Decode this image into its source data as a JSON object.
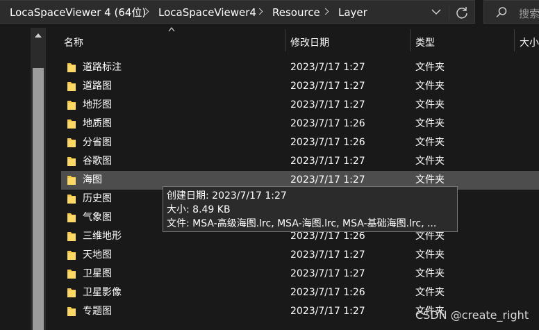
{
  "address_bar": {
    "breadcrumbs": [
      "LocaSpaceViewer 4 (64位)",
      "LocaSpaceViewer4",
      "Resource",
      "Layer"
    ]
  },
  "search": {
    "placeholder": "搜索"
  },
  "columns": {
    "name": "名称",
    "date": "修改日期",
    "type": "类型",
    "size": "大小"
  },
  "rows": [
    {
      "name": "道路标注",
      "date": "2023/7/17 1:27",
      "type": "文件夹"
    },
    {
      "name": "道路图",
      "date": "2023/7/17 1:27",
      "type": "文件夹"
    },
    {
      "name": "地形图",
      "date": "2023/7/17 1:27",
      "type": "文件夹"
    },
    {
      "name": "地质图",
      "date": "2023/7/17 1:26",
      "type": "文件夹"
    },
    {
      "name": "分省图",
      "date": "2023/7/17 1:26",
      "type": "文件夹"
    },
    {
      "name": "谷歌图",
      "date": "2023/7/17 1:27",
      "type": "文件夹"
    },
    {
      "name": "海图",
      "date": "2023/7/17 1:27",
      "type": "文件夹"
    },
    {
      "name": "历史图",
      "date": "",
      "type": ""
    },
    {
      "name": "气象图",
      "date": "",
      "type": ""
    },
    {
      "name": "三维地形",
      "date": "2023/7/17 1:26",
      "type": "文件夹"
    },
    {
      "name": "天地图",
      "date": "2023/7/17 1:27",
      "type": "文件夹"
    },
    {
      "name": "卫星图",
      "date": "2023/7/17 1:27",
      "type": "文件夹"
    },
    {
      "name": "卫星影像",
      "date": "2023/7/17 1:26",
      "type": "文件夹"
    },
    {
      "name": "专题图",
      "date": "2023/7/17 1:27",
      "type": "文件夹"
    }
  ],
  "hovered_row": "海图",
  "tooltip": {
    "created": "创建日期: 2023/7/17 1:27",
    "size": "大小: 8.49 KB",
    "files": "文件: MSA-高级海图.lrc, MSA-海图.lrc, MSA-基础海图.lrc, ..."
  },
  "watermark": "CSDN @create_right",
  "colors": {
    "background": "#191919",
    "hover_row": "#4d4d4d",
    "folder": "#f7c94a",
    "tooltip_bg": "#2b2b2b"
  }
}
